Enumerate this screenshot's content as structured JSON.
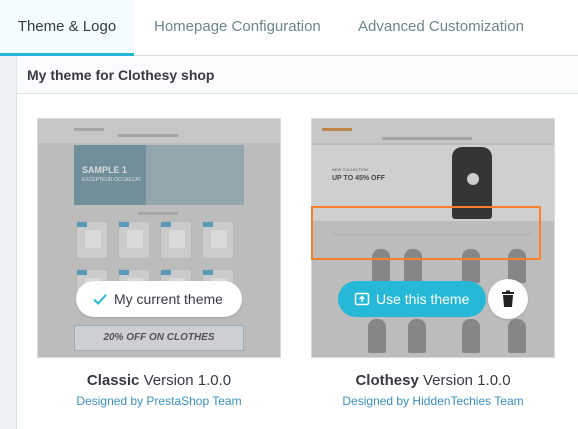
{
  "tabs": [
    {
      "label": "Theme & Logo",
      "active": true
    },
    {
      "label": "Homepage Configuration",
      "active": false
    },
    {
      "label": "Advanced Customization",
      "active": false
    }
  ],
  "panel": {
    "title": "My theme for Clothesy shop"
  },
  "themes": [
    {
      "name": "Classic",
      "version": "Version 1.0.0",
      "designer": "Designed by PrestaShop Team",
      "action_label": "My current theme",
      "action_icon": "check-icon",
      "preview_banner": "SAMPLE 1",
      "preview_banner_sub": "EXCEPTEUR OCCAECAT",
      "preview_sale": "20% OFF ON CLOTHES"
    },
    {
      "name": "Clothesy",
      "version": "Version 1.0.0",
      "designer": "Designed by HiddenTechies Team",
      "action_label": "Use this theme",
      "action_icon": "upload-icon",
      "delete_icon": "trash-icon",
      "preview_hero": "UP TO 45% OFF",
      "preview_hero_sub": "NEW COLLECTION"
    }
  ],
  "colors": {
    "accent": "#25b9d7",
    "highlight": "#ff7f2a",
    "link": "#3a8fc2",
    "text": "#363a41"
  }
}
